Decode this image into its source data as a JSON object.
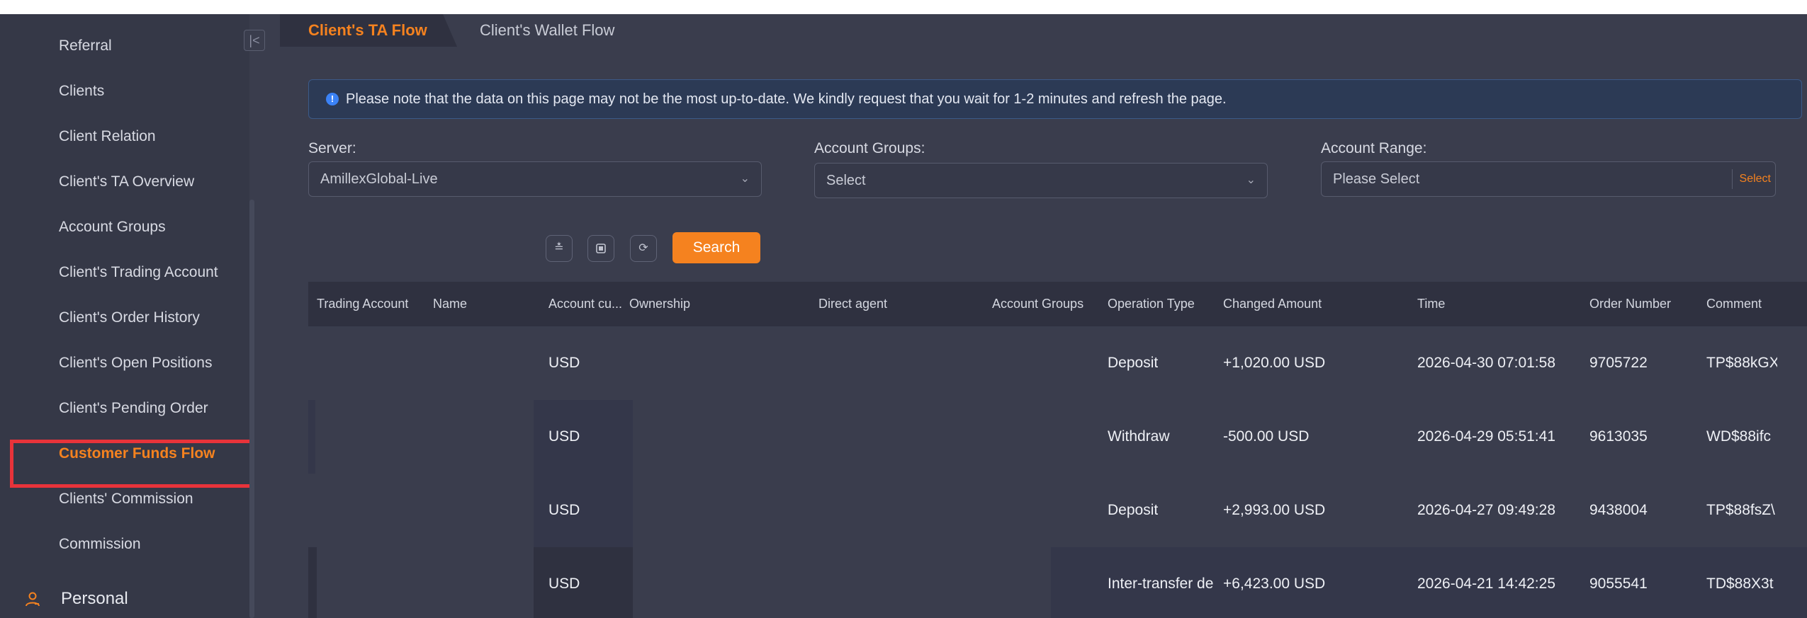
{
  "sidebar": {
    "collapse_icon": "collapse-left-icon",
    "items": [
      {
        "label": "Referral",
        "active": false
      },
      {
        "label": "Clients",
        "active": false
      },
      {
        "label": "Client Relation",
        "active": false
      },
      {
        "label": "Client's TA Overview",
        "active": false
      },
      {
        "label": "Account Groups",
        "active": false
      },
      {
        "label": "Client's Trading Account",
        "active": false
      },
      {
        "label": "Client's Order History",
        "active": false
      },
      {
        "label": "Client's Open Positions",
        "active": false
      },
      {
        "label": "Client's Pending Order",
        "active": false
      },
      {
        "label": "Customer Funds Flow",
        "active": true
      },
      {
        "label": "Clients' Commission",
        "active": false
      },
      {
        "label": "Commission",
        "active": false
      }
    ],
    "personal": {
      "label": "Personal",
      "icon": "person-icon"
    }
  },
  "tabs": [
    {
      "label": "Client's TA Flow",
      "active": true
    },
    {
      "label": "Client's Wallet Flow",
      "active": false
    }
  ],
  "notice": {
    "icon": "info-icon",
    "text": "Please note that the data on this page may not be the most up-to-date. We kindly request that you wait for 1-2 minutes and refresh the page."
  },
  "filters": {
    "server": {
      "label": "Server:",
      "value": "AmillexGlobal-Live"
    },
    "account_groups": {
      "label": "Account Groups:",
      "placeholder": "Select"
    },
    "account_range": {
      "label": "Account Range:",
      "placeholder": "Please Select",
      "select_button": "Select"
    }
  },
  "toolbar": {
    "expand_icon": "chevrons-down-icon",
    "export_icon": "export-icon",
    "refresh_icon": "refresh-icon",
    "search_label": "Search"
  },
  "table": {
    "headers": [
      "Trading Account",
      "Name",
      "Account cu...",
      "Ownership",
      "Direct agent",
      "Account Groups",
      "Operation Type",
      "Changed Amount",
      "Time",
      "Order Number",
      "Comment"
    ],
    "rows": [
      {
        "currency": "USD",
        "operation": "Deposit",
        "amount": "+1,020.00 USD",
        "time": "2026-04-30 07:01:58",
        "order": "9705722",
        "comment": "TP$88kGX"
      },
      {
        "currency": "USD",
        "operation": "Withdraw",
        "amount": "-500.00 USD",
        "time": "2026-04-29 05:51:41",
        "order": "9613035",
        "comment": "WD$88ifc"
      },
      {
        "currency": "USD",
        "operation": "Deposit",
        "amount": "+2,993.00 USD",
        "time": "2026-04-27 09:49:28",
        "order": "9438004",
        "comment": "TP$88fsZ\\"
      },
      {
        "currency": "USD",
        "operation": "Inter-transfer de",
        "amount": "+6,423.00 USD",
        "time": "2026-04-21 14:42:25",
        "order": "9055541",
        "comment": "TD$88X3t"
      }
    ]
  },
  "colors": {
    "accent": "#f5821f",
    "highlight_box": "#e8333a",
    "info": "#3b82f6"
  }
}
